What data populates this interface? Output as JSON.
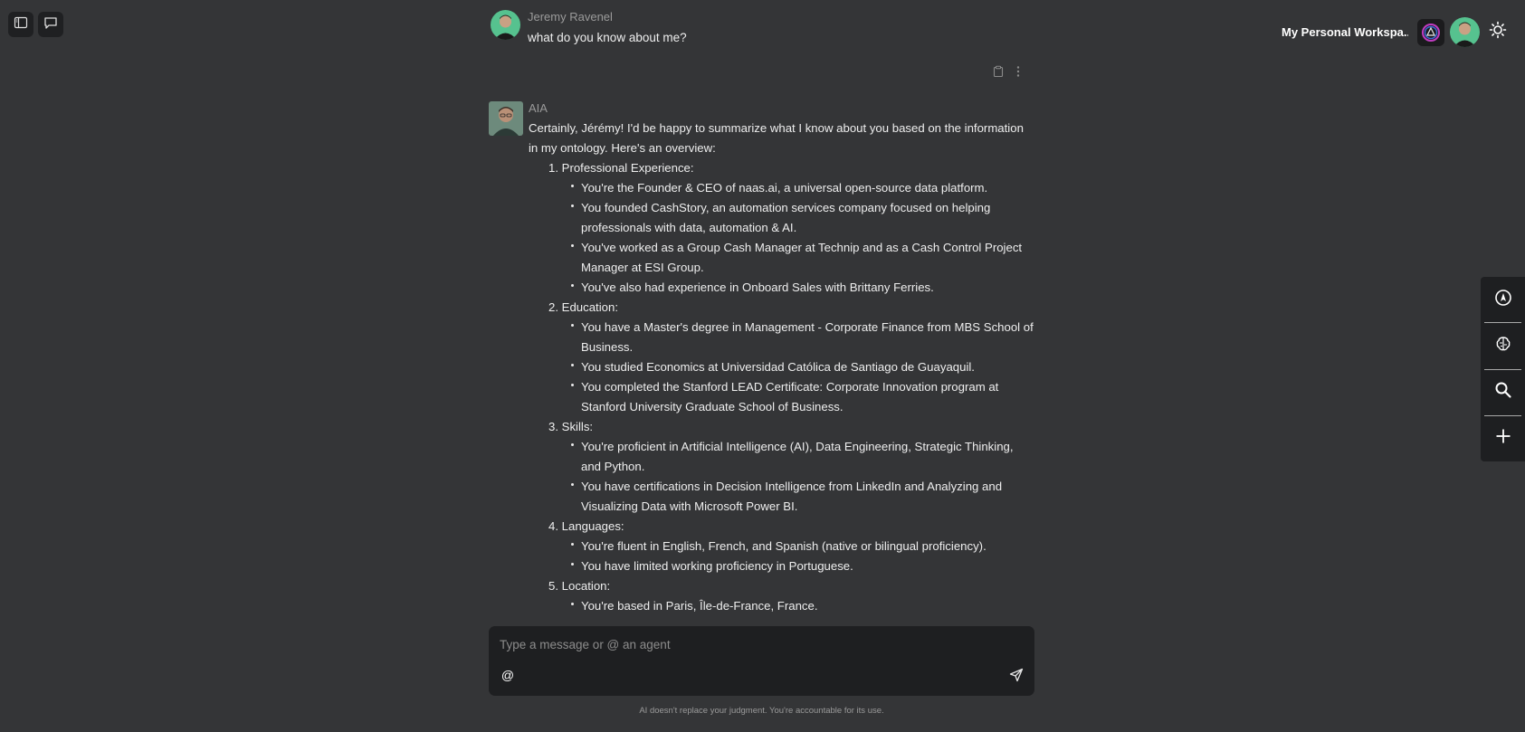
{
  "topbar": {
    "workspace_name": "My Personal Workspa..."
  },
  "conversation": {
    "user_message": {
      "author": "Jeremy Ravenel",
      "text": "what do you know about me?"
    },
    "ai_message": {
      "author": "AIA",
      "intro": "Certainly, Jérémy! I'd be happy to summarize what I know about you based on the information in my ontology. Here's an overview:",
      "sections": [
        {
          "heading": "1. Professional Experience:",
          "points": [
            "You're the Founder & CEO of naas.ai, a universal open-source data platform.",
            "You founded CashStory, an automation services company focused on helping professionals with data, automation & AI.",
            "You've worked as a Group Cash Manager at Technip and as a Cash Control Project Manager at ESI Group.",
            "You've also had experience in Onboard Sales with Brittany Ferries."
          ]
        },
        {
          "heading": "2. Education:",
          "points": [
            "You have a Master's degree in Management - Corporate Finance from MBS School of Business.",
            "You studied Economics at Universidad Católica de Santiago de Guayaquil.",
            "You completed the Stanford LEAD Certificate: Corporate Innovation program at Stanford University Graduate School of Business."
          ]
        },
        {
          "heading": "3. Skills:",
          "points": [
            "You're proficient in Artificial Intelligence (AI), Data Engineering, Strategic Thinking, and Python.",
            "You have certifications in Decision Intelligence from LinkedIn and Analyzing and Visualizing Data with Microsoft Power BI."
          ]
        },
        {
          "heading": "4. Languages:",
          "points": [
            "You're fluent in English, French, and Spanish (native or bilingual proficiency).",
            "You have limited working proficiency in Portuguese."
          ]
        },
        {
          "heading": "5. Location:",
          "points": [
            "You're based in Paris, Île-de-France, France."
          ]
        }
      ]
    }
  },
  "composer": {
    "placeholder": "Type a message or @ an agent",
    "mention_symbol": "@"
  },
  "disclaimer": "AI doesn't replace your judgment. You're accountable for its use.",
  "icons": {
    "top_left": [
      "sidebar-toggle-icon",
      "chat-bubble-icon"
    ],
    "top_right": [
      "workspace-logo-icon",
      "user-avatar",
      "sun-icon"
    ],
    "message_actions": [
      "clipboard-icon",
      "more-vertical-icon"
    ],
    "side_rail": [
      "compass-icon",
      "brain-icon",
      "search-icon",
      "plus-icon"
    ],
    "composer": [
      "at-icon",
      "send-icon"
    ]
  },
  "colors": {
    "background": "#343537",
    "panel": "#1e1f21",
    "text": "#eeeeee",
    "muted": "#9a9a9a"
  }
}
